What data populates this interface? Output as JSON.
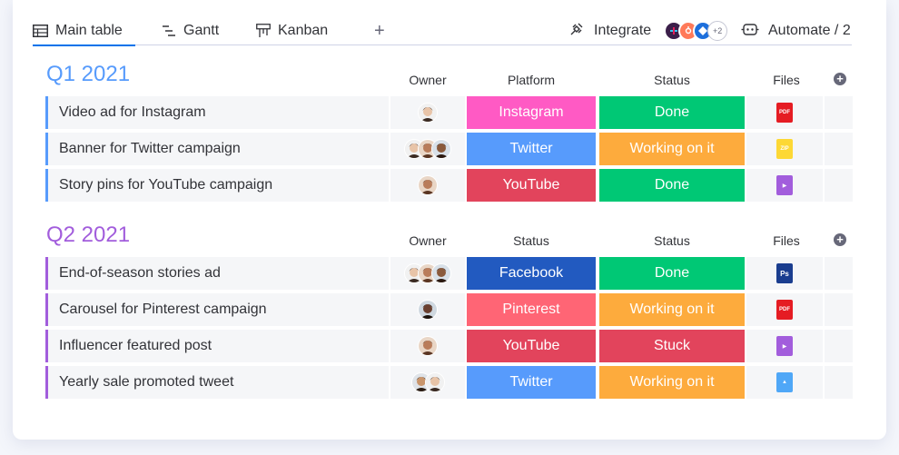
{
  "tabs": [
    {
      "label": "Main table",
      "icon": "table-icon"
    },
    {
      "label": "Gantt",
      "icon": "gantt-icon"
    },
    {
      "label": "Kanban",
      "icon": "kanban-icon"
    }
  ],
  "add_tab": "+",
  "integrate": {
    "label": "Integrate",
    "more_count": "+2"
  },
  "automate": {
    "label": "Automate / 2"
  },
  "groups": [
    {
      "title": "Q1 2021",
      "color": "#579bfc",
      "columns": {
        "owner": "Owner",
        "col3": "Platform",
        "col4": "Status",
        "files": "Files"
      },
      "rows": [
        {
          "name": "Video ad for Instagram",
          "owners": [
            "m1"
          ],
          "platform": {
            "label": "Instagram",
            "color": "#ff5ac4"
          },
          "status": {
            "label": "Done",
            "color": "#00c875"
          },
          "file": "pdf"
        },
        {
          "name": "Banner for Twitter campaign",
          "owners": [
            "m1",
            "w1",
            "w2"
          ],
          "platform": {
            "label": "Twitter",
            "color": "#579bfc"
          },
          "status": {
            "label": "Working on it",
            "color": "#fdab3d"
          },
          "file": "zip"
        },
        {
          "name": "Story pins for YouTube campaign",
          "owners": [
            "w1"
          ],
          "platform": {
            "label": "YouTube",
            "color": "#e2445c"
          },
          "status": {
            "label": "Done",
            "color": "#00c875"
          },
          "file": "video"
        }
      ]
    },
    {
      "title": "Q2 2021",
      "color": "#a25ddc",
      "columns": {
        "owner": "Owner",
        "col3": "Status",
        "col4": "Status",
        "files": "Files"
      },
      "rows": [
        {
          "name": "End-of-season stories ad",
          "owners": [
            "m1",
            "w1",
            "w2"
          ],
          "platform": {
            "label": "Facebook",
            "color": "#225ac0"
          },
          "status": {
            "label": "Done",
            "color": "#00c875"
          },
          "file": "ps"
        },
        {
          "name": "Carousel for Pinterest campaign",
          "owners": [
            "w3"
          ],
          "platform": {
            "label": "Pinterest",
            "color": "#ff6575"
          },
          "status": {
            "label": "Working on it",
            "color": "#fdab3d"
          },
          "file": "pdf"
        },
        {
          "name": "Influencer featured post",
          "owners": [
            "w1"
          ],
          "platform": {
            "label": "YouTube",
            "color": "#e2445c"
          },
          "status": {
            "label": "Stuck",
            "color": "#e2445c"
          },
          "file": "video"
        },
        {
          "name": "Yearly sale promoted tweet",
          "owners": [
            "m2",
            "m1"
          ],
          "platform": {
            "label": "Twitter",
            "color": "#579bfc"
          },
          "status": {
            "label": "Working on it",
            "color": "#fdab3d"
          },
          "file": "image"
        }
      ]
    }
  ]
}
